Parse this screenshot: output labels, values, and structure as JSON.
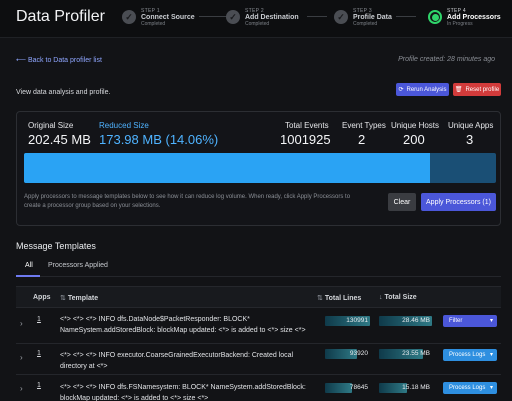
{
  "page": {
    "title": "Data Profiler"
  },
  "steps": [
    {
      "num": "STEP 1",
      "name": "Connect Source",
      "status": "Completed"
    },
    {
      "num": "STEP 2",
      "name": "Add Destination",
      "status": "Completed"
    },
    {
      "num": "STEP 3",
      "name": "Profile Data",
      "status": "Completed"
    },
    {
      "num": "STEP 4",
      "name": "Add Processors",
      "status": "In Progress"
    }
  ],
  "nav": {
    "back_label": "Back to Data profiler list",
    "profile_created": "Profile created: 28 minutes ago"
  },
  "actions": {
    "view_text": "View data analysis and profile.",
    "rerun_label": "Rerun Analysis",
    "reset_label": "Reset profile"
  },
  "stats": {
    "original_label": "Original Size",
    "original_value": "202.45 MB",
    "reduced_label": "Reduced Size",
    "reduced_value": "173.98 MB (14.06%)",
    "events_label": "Total Events",
    "events_value": "1001925",
    "types_label": "Event Types",
    "types_value": "2",
    "hosts_label": "Unique Hosts",
    "hosts_value": "200",
    "apps_label": "Unique Apps",
    "apps_value": "3",
    "reduced_fraction": 0.8594,
    "description": "Apply processors to message templates below to see how it can reduce log volume. When ready, click Apply Processors to create a processor group based on your selections.",
    "clear_label": "Clear",
    "apply_label": "Apply Processors (1)"
  },
  "templates": {
    "title": "Message Templates",
    "tabs": [
      {
        "label": "All",
        "active": true
      },
      {
        "label": "Processors Applied",
        "active": false
      }
    ],
    "columns": {
      "apps": "Apps",
      "template": "Template",
      "total_lines": "Total Lines",
      "total_size": "Total Size"
    },
    "rows": [
      {
        "apps": "1",
        "template": "<*> <*> <*> INFO dfs.DataNode$PacketResponder: BLOCK* NameSystem.addStoredBlock: blockMap updated: <*> is added to <*> size <*>",
        "lines": "130991",
        "size": "28.46 MB",
        "lines_fraction": 1.0,
        "size_fraction": 1.0,
        "action": "Filter"
      },
      {
        "apps": "1",
        "template": "<*> <*> <*> INFO executor.CoarseGrainedExecutorBackend: Created local directory at <*>",
        "lines": "93920",
        "size": "23.55 MB",
        "lines_fraction": 0.72,
        "size_fraction": 0.83,
        "action": "Process Logs"
      },
      {
        "apps": "1",
        "template": "<*> <*> <*> INFO dfs.FSNamesystem: BLOCK* NameSystem.addStoredBlock: blockMap updated: <*> is added to <*> size <*>",
        "lines": "78645",
        "size": "15.18 MB",
        "lines_fraction": 0.6,
        "size_fraction": 0.53,
        "action": "Process Logs"
      }
    ]
  }
}
